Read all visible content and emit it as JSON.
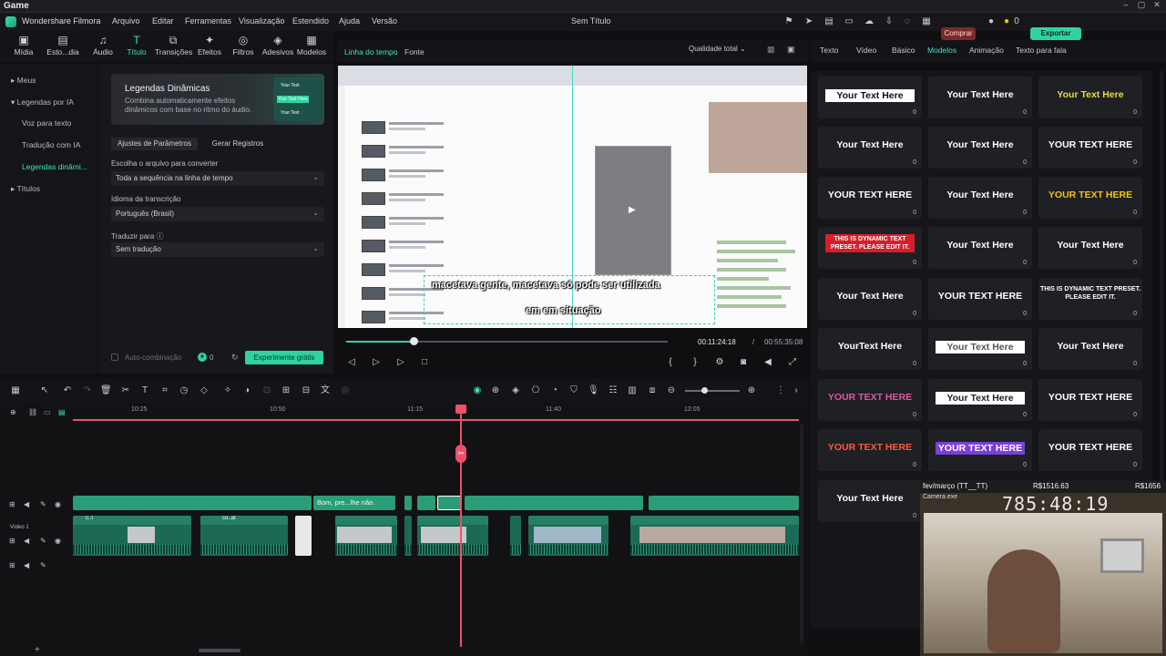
{
  "os": {
    "title": "Game"
  },
  "menu": {
    "app": "Wondershare Filmora",
    "items": [
      "Arquivo",
      "Editar",
      "Ferramentas",
      "Visualização",
      "Estendido",
      "Ajuda",
      "Versão"
    ],
    "doc_title": "Sem Título",
    "buy": "Comprar",
    "coins": "0",
    "export": "Exportar"
  },
  "tools": [
    {
      "label": "Mídia",
      "icon": "▣"
    },
    {
      "label": "Esto...dia",
      "icon": "▤"
    },
    {
      "label": "Áudio",
      "icon": "♫"
    },
    {
      "label": "Título",
      "icon": "T"
    },
    {
      "label": "Transições",
      "icon": "⧉"
    },
    {
      "label": "Efeitos",
      "icon": "✦"
    },
    {
      "label": "Filtros",
      "icon": "◎"
    },
    {
      "label": "Adesivos",
      "icon": "◈"
    },
    {
      "label": "Modelos",
      "icon": "▦"
    }
  ],
  "leftnav": {
    "items": [
      "Meus",
      "Legendas por IA",
      "Voz para texto",
      "Tradução com IA",
      "Legendas dinâmi...",
      "Títulos"
    ]
  },
  "panel": {
    "banner_title": "Legendas Dinâmicas",
    "banner_desc": "Combina automaticamente efeitos dinâmicos com base no ritmo do áudio.",
    "thumb_line1": "Your Text",
    "thumb_line2": "Your Text Here",
    "thumb_line3": "Your Text",
    "tab1": "Ajustes de Parâmetros",
    "tab2": "Gerar Registros",
    "l_convert": "Escolha o arquivo para converter",
    "v_convert": "Toda a sequência na linha de tempo",
    "l_lang": "Idioma da transcrição",
    "v_lang": "Português (Brasil)",
    "l_translate": "Traduzir para",
    "v_translate": "Sem tradução",
    "autocomb": "Auto-combinação",
    "credits": "0",
    "try": "Experimente grátis"
  },
  "preview": {
    "tab_timeline": "Linha do tempo",
    "tab_source": "Fonte",
    "quality": "Qualidade total",
    "caption1": "macetava gente, macetava só pode ser utilizada",
    "caption2": "em em situação",
    "time_current": "00:11:24:18",
    "time_sep": "/",
    "time_total": "00:55:35:08",
    "progress": 0.21
  },
  "right": {
    "tabs": [
      "Texto",
      "Vídeo",
      "Básico",
      "Modelos",
      "Animação",
      "Texto para fala"
    ],
    "cards": [
      {
        "text": "Your Text Here",
        "color": "#111",
        "bg": "#fff",
        "count": "0"
      },
      {
        "text": "Your Text Here",
        "color": "#fff",
        "bg": "",
        "count": "0"
      },
      {
        "text": "Your Text Here",
        "color": "#e9d84a",
        "bg": "",
        "count": "0"
      },
      {
        "text": "Your Text Here",
        "color": "#fff",
        "bg": "",
        "count": "0"
      },
      {
        "text": "Your Text Here",
        "color": "#fff",
        "bg": "",
        "count": "0"
      },
      {
        "text": "YOUR TEXT HERE",
        "color": "#fff",
        "bg": "",
        "count": "0"
      },
      {
        "text": "YOUR TEXT HERE",
        "color": "#fff",
        "bg": "",
        "count": "0"
      },
      {
        "text": "Your Text Here",
        "color": "#fff",
        "bg": "",
        "count": "0"
      },
      {
        "text": "YOUR TEXT HERE",
        "color": "#f2c21b",
        "bg": "",
        "count": "0"
      },
      {
        "text": "THIS IS DYNAMIC TEXT PRESET. PLEASE EDIT IT.",
        "color": "#fff",
        "bg": "#d71e2a",
        "count": "0"
      },
      {
        "text": "Your Text Here",
        "color": "#fff",
        "bg": "",
        "count": "0"
      },
      {
        "text": "Your Text Here",
        "color": "#fff",
        "bg": "",
        "count": "0"
      },
      {
        "text": "Your Text Here",
        "color": "#fff",
        "bg": "",
        "count": "0"
      },
      {
        "text": "YOUR TEXT HERE",
        "color": "#fff",
        "bg": "",
        "count": "0"
      },
      {
        "text": "THIS IS DYNAMIC TEXT PRESET. PLEASE EDIT IT.",
        "color": "#fff",
        "bg": "",
        "count": "0"
      },
      {
        "text": "YourText Here",
        "color": "#fff",
        "bg": "",
        "count": "0"
      },
      {
        "text": "Your Text Here",
        "color": "#555",
        "bg": "#fff",
        "count": "0"
      },
      {
        "text": "Your Text Here",
        "color": "#fff",
        "bg": "",
        "count": "0"
      },
      {
        "text": "YOUR TEXT HERE",
        "color": "#d85aa0",
        "bg": "",
        "count": "0"
      },
      {
        "text": "Your Text Here",
        "color": "#222",
        "bg": "#fff",
        "count": "0"
      },
      {
        "text": "YOUR TEXT HERE",
        "color": "#fff",
        "bg": "",
        "count": "0"
      },
      {
        "text": "YOUR TEXT HERE",
        "color": "#ff5a3a",
        "bg": "",
        "count": "0"
      },
      {
        "text": "YOUR TEXT HERE",
        "color": "#fff",
        "bg": "#7a3fd6",
        "count": "0"
      },
      {
        "text": "YOUR TEXT HERE",
        "color": "#fff",
        "bg": "",
        "count": "0"
      },
      {
        "text": "Your Text Here",
        "color": "#fff",
        "bg": "",
        "count": "0"
      },
      {
        "text": "Your Text Here",
        "color": "#fff",
        "bg": "",
        "count": "0"
      },
      {
        "text": "Your Text Here",
        "color": "#fff",
        "bg": "",
        "count": "0"
      }
    ]
  },
  "webcam": {
    "label": "fev/março (TT__TT)",
    "value_center": "R$1516.63",
    "value_right": "R$1656",
    "sub": "Camera.exe",
    "clock": "785:48:19"
  },
  "timeline": {
    "ruler": [
      "10:25",
      "10:50",
      "11:15",
      "11:40",
      "12:05"
    ],
    "track_video_label": "Vídeo 1",
    "clip_text1": "Bom, pre...lhe não.",
    "clip_text2": "c..t",
    "clip_text3": "co..at"
  }
}
